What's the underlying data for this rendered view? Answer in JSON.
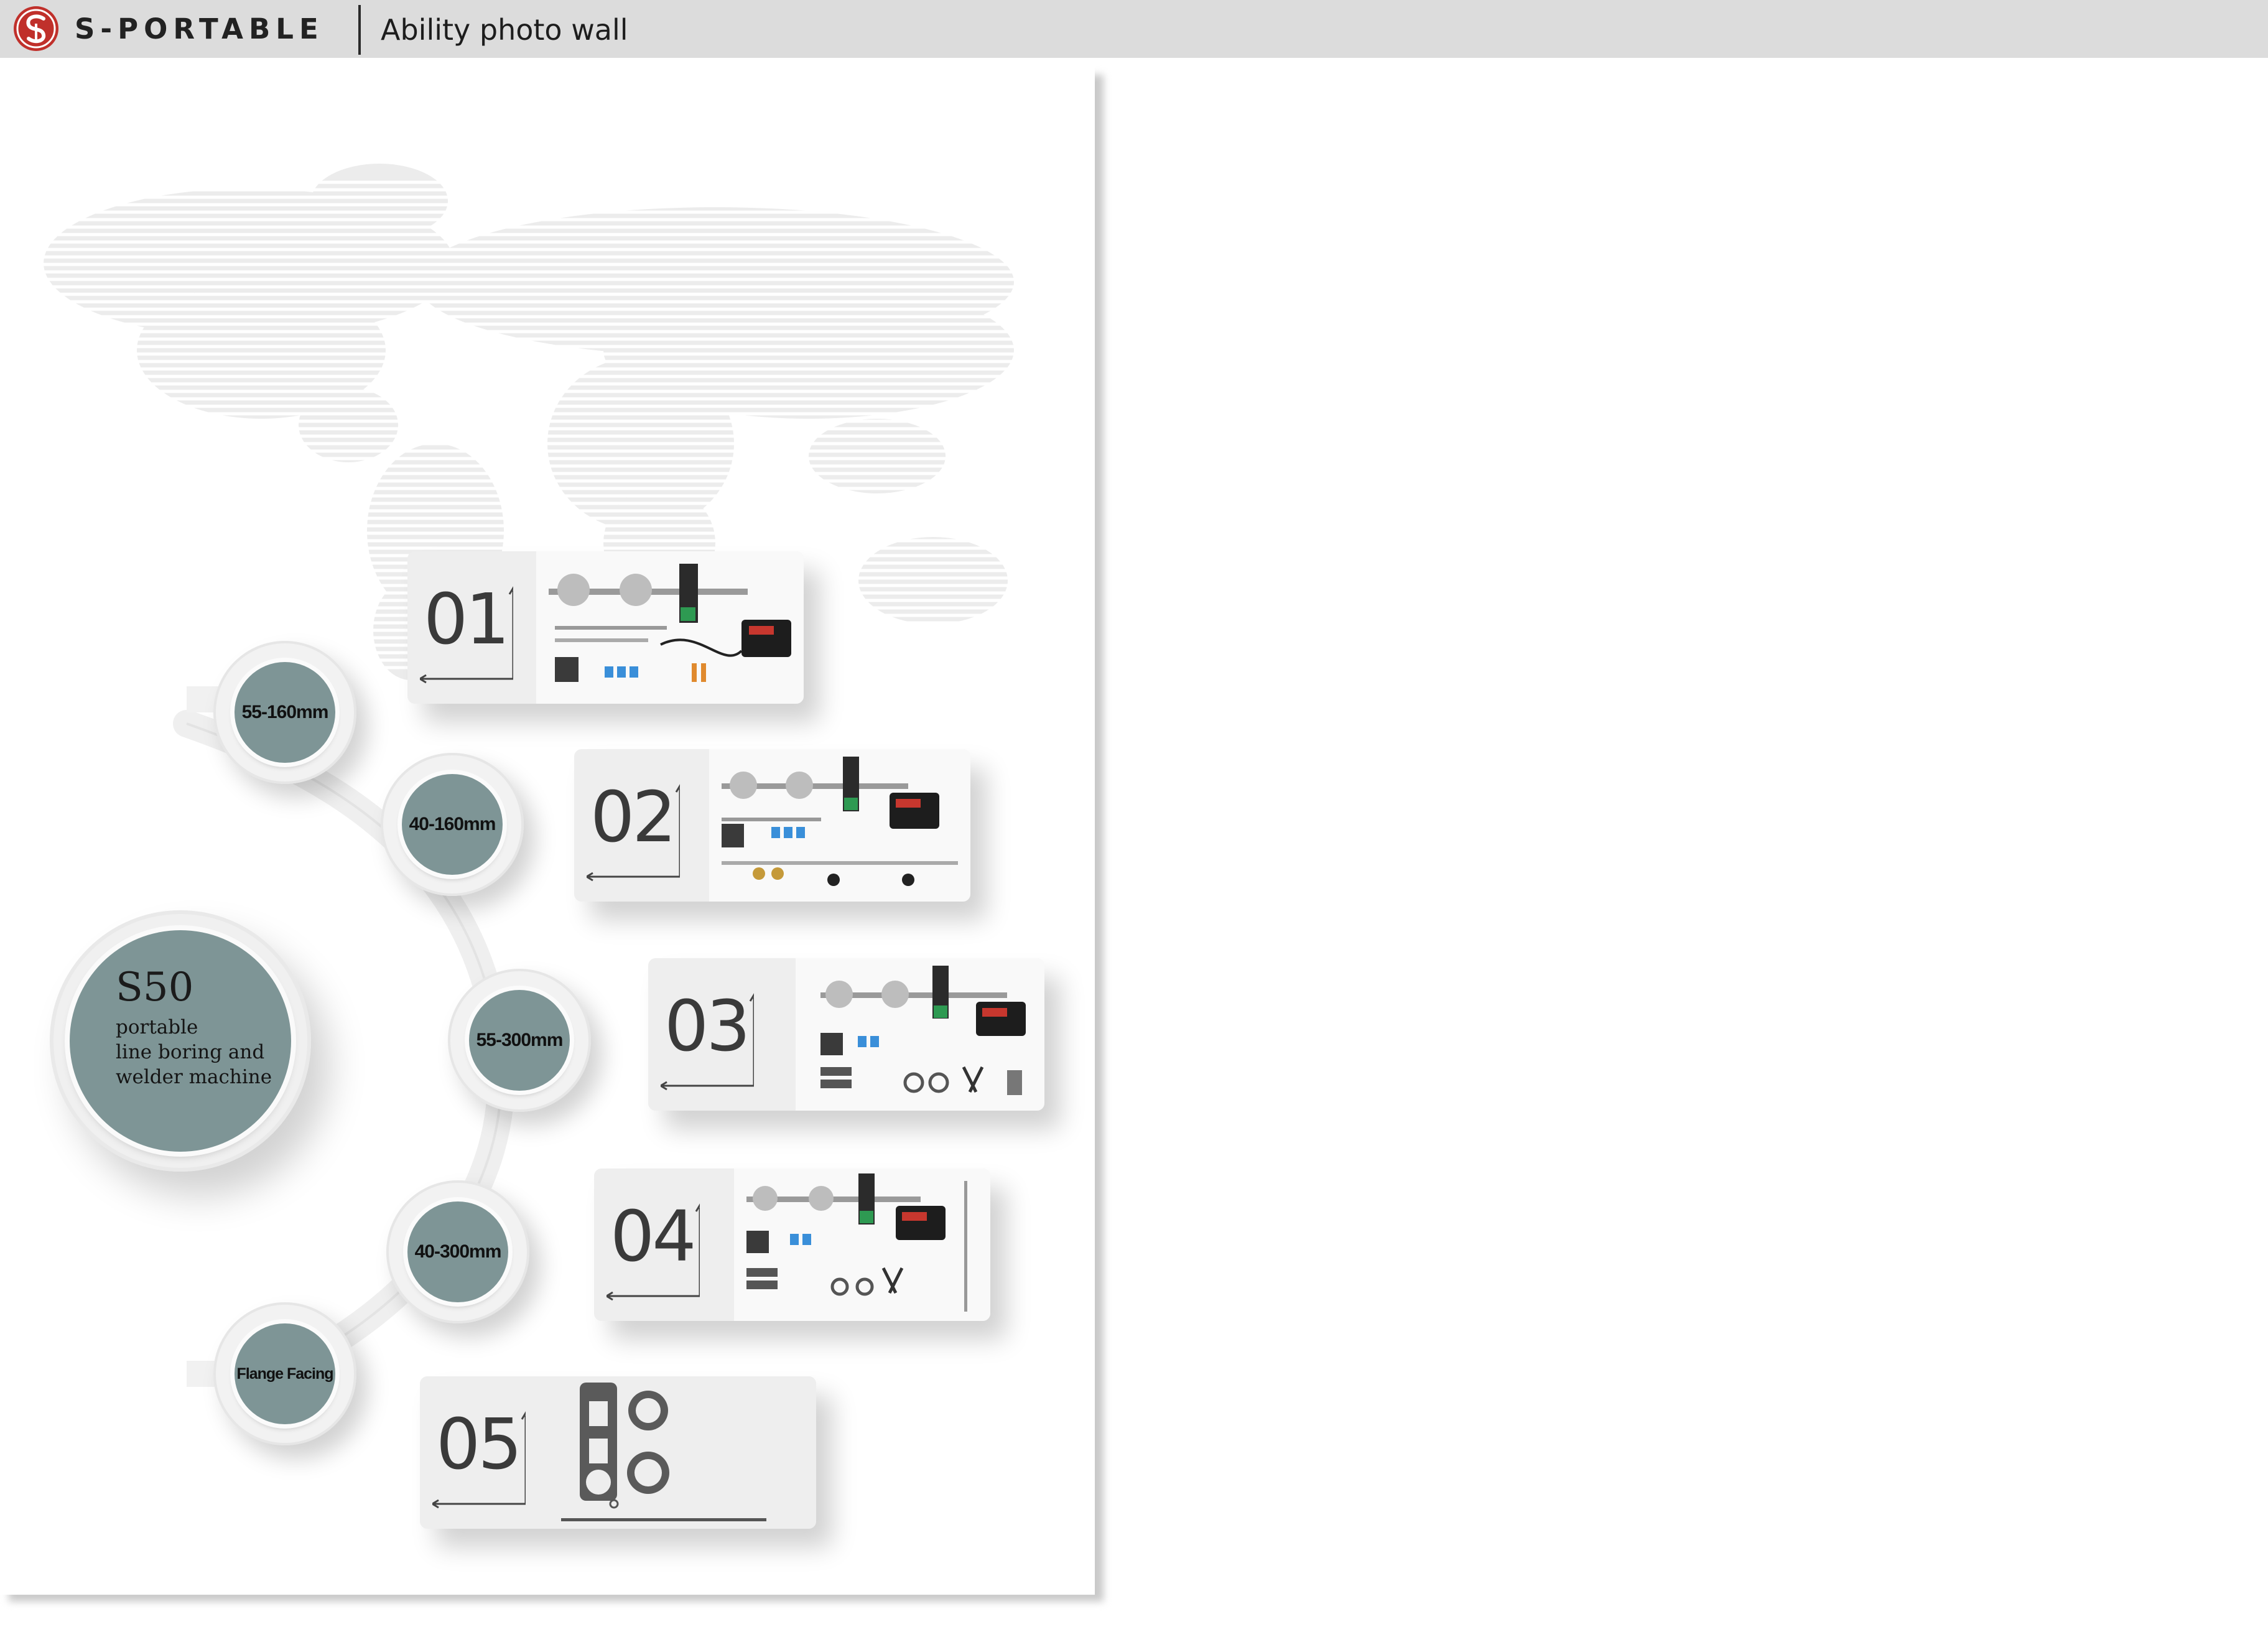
{
  "header": {
    "brand": "S-PORTABLE",
    "title": "Ability photo wall",
    "logo_icon": "s-portable-logo-icon",
    "accent_color": "#c0302b"
  },
  "poster": {
    "center": {
      "model": "S50",
      "lines": [
        "portable",
        "line boring and",
        "welder machine"
      ]
    },
    "nodes": [
      {
        "label": "55-160mm"
      },
      {
        "label": "40-160mm"
      },
      {
        "label": "55-300mm"
      },
      {
        "label": "40-300mm"
      },
      {
        "label": "Flange Facing"
      }
    ],
    "cards": [
      {
        "number": "01"
      },
      {
        "number": "02"
      },
      {
        "number": "03"
      },
      {
        "number": "04"
      },
      {
        "number": "05"
      }
    ]
  }
}
